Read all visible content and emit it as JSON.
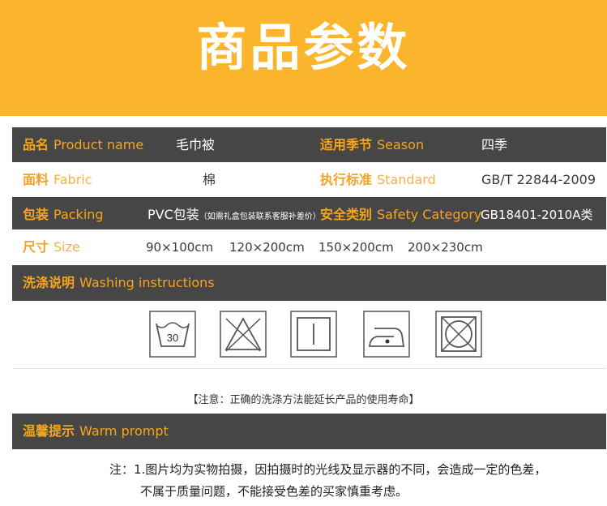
{
  "banner": {
    "title": "商品参数",
    "color": "#fbb52d"
  },
  "params": {
    "product_name": {
      "cn": "品名",
      "en": "Product name",
      "value": "毛巾被"
    },
    "season": {
      "cn": "适用季节",
      "en": "Season",
      "value": "四季"
    },
    "fabric": {
      "cn": "面料",
      "en": "Fabric",
      "value": "棉"
    },
    "standard": {
      "cn": "执行标准",
      "en": "Standard",
      "value": "GB/T 22844-2009"
    },
    "packing": {
      "cn": "包装",
      "en": "Packing",
      "value": "PVC包装",
      "value_note": "（如需礼盒包装联系客服补差价）"
    },
    "safety": {
      "cn": "安全类别",
      "en": "Safety Category",
      "value": "GB18401-2010A类"
    },
    "size": {
      "cn": "尺寸",
      "en": "Size",
      "values": [
        "90×100cm",
        "120×200cm",
        "150×200cm",
        "200×230cm"
      ]
    }
  },
  "washing": {
    "cn": "洗涤说明",
    "en": "Washing instructions",
    "icons": [
      "wash-30-icon",
      "do-not-bleach-icon",
      "line-dry-icon",
      "iron-low-icon",
      "do-not-tumble-dry-icon"
    ],
    "wash_temp": "30",
    "note": "【注意：正确的洗涤方法能延长产品的使用寿命】"
  },
  "warm_prompt": {
    "cn": "温馨提示",
    "en": "Warm prompt",
    "line1": "注：1.图片均为实物拍摄，因拍摄时的光线及显示器的不同，会造成一定的色差，",
    "line2": "不属于质量问题，不能接受色差的买家慎重考虑。"
  },
  "colors": {
    "accent": "#f7a51b",
    "dark_row": "#464646"
  }
}
